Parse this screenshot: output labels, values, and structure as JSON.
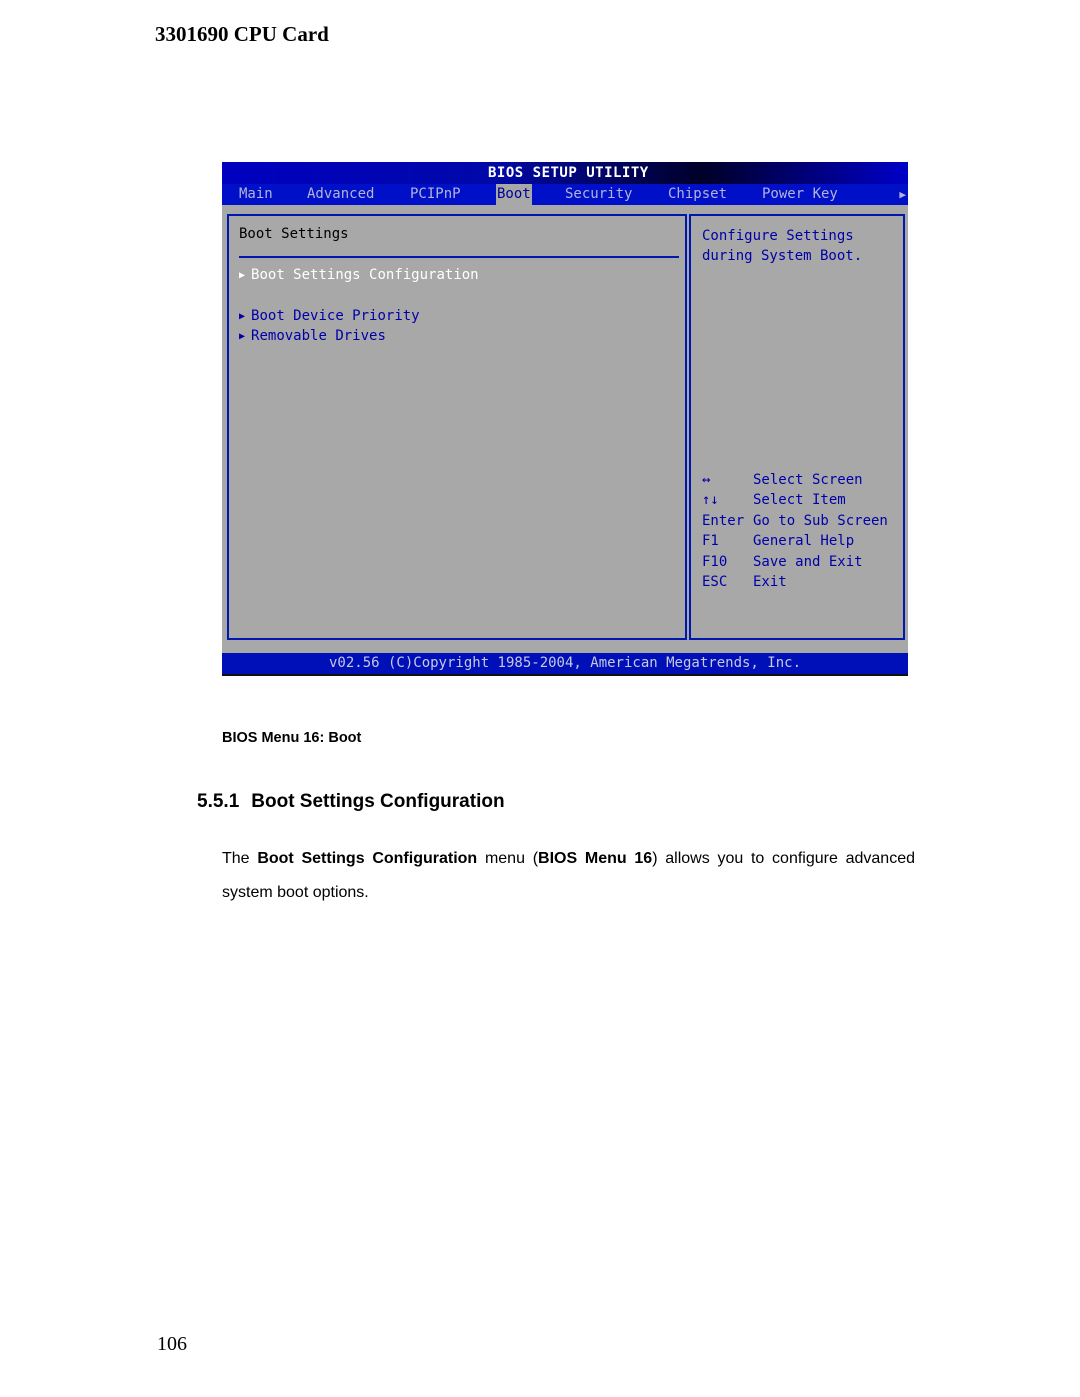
{
  "document": {
    "header": "3301690 CPU Card",
    "page_number": "106",
    "caption": "BIOS Menu 16: Boot",
    "section": {
      "number": "5.5.1",
      "title": "Boot Settings Configuration"
    },
    "paragraph": {
      "p1": "The ",
      "b1": "Boot Settings Configuration",
      "p2": " menu (",
      "b2": "BIOS Menu 16",
      "p3": ") allows you to configure advanced system boot options."
    }
  },
  "bios": {
    "title": "BIOS SETUP UTILITY",
    "tabs": [
      {
        "label": "Main",
        "active": false
      },
      {
        "label": "Advanced",
        "active": false
      },
      {
        "label": "PCIPnP",
        "active": false
      },
      {
        "label": "Boot",
        "active": true
      },
      {
        "label": "Security",
        "active": false
      },
      {
        "label": "Chipset",
        "active": false
      },
      {
        "label": "Power Key",
        "active": false
      }
    ],
    "more_tabs_icon": "▶",
    "section_title": "Boot Settings",
    "menu_items": [
      {
        "label": "Boot Settings Configuration",
        "selected": true
      },
      {
        "label": "Boot Device Priority",
        "selected": false
      },
      {
        "label": "Removable Drives",
        "selected": false
      }
    ],
    "submenu_arrow": "▶",
    "help_text": "Configure Settings\nduring System Boot.",
    "key_legend": [
      {
        "key": "↔",
        "action": "Select Screen"
      },
      {
        "key": "↑↓",
        "action": "Select Item"
      },
      {
        "key": "Enter",
        "action": "Go to Sub Screen"
      },
      {
        "key": "F1",
        "action": "General Help"
      },
      {
        "key": "F10",
        "action": "Save and Exit"
      },
      {
        "key": "ESC",
        "action": "Exit"
      }
    ],
    "footer": "v02.56 (C)Copyright 1985-2004, American Megatrends, Inc.",
    "colors": {
      "background": "#a8a8a8",
      "tab_bar": "#0010c8",
      "text_blue": "#0000a8",
      "selected_text": "#ffffff"
    }
  }
}
